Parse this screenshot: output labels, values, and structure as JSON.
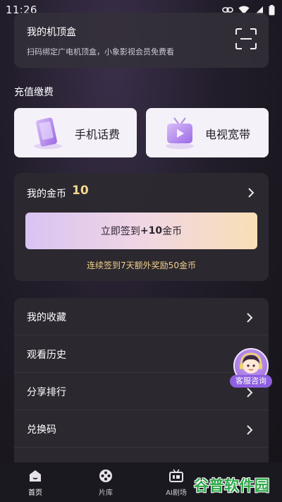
{
  "status_bar": {
    "time": "11:26",
    "icons": [
      "link-icon",
      "wifi-icon",
      "signal-icon",
      "battery-icon"
    ]
  },
  "set_top_box": {
    "title": "我的机顶盒",
    "subtitle": "扫码绑定广电机顶盒，小象影视会员免费看",
    "icon": "scan-icon"
  },
  "recharge": {
    "section_title": "充值缴费",
    "items": [
      {
        "label": "手机话费",
        "icon": "phone-icon"
      },
      {
        "label": "电视宽带",
        "icon": "tv-icon"
      }
    ]
  },
  "coins": {
    "label": "我的金币",
    "count": "10",
    "checkin_prefix": "立即签到",
    "checkin_bonus": "+10",
    "checkin_suffix": "金币",
    "streak_note": "连续签到7天额外奖励50金币"
  },
  "menu": {
    "items": [
      {
        "label": "我的收藏"
      },
      {
        "label": "观看历史"
      },
      {
        "label": "分享排行"
      },
      {
        "label": "兑换码"
      }
    ]
  },
  "customer_service": {
    "label": "客服咨询"
  },
  "tab_bar": {
    "items": [
      {
        "label": "首页",
        "icon": "home-icon"
      },
      {
        "label": "片库",
        "icon": "film-reel-icon"
      },
      {
        "label": "AI剧场",
        "icon": "ai-tv-icon"
      }
    ]
  },
  "watermark": {
    "text": "谷普软件园"
  },
  "colors": {
    "accent_gold": "#f2d98a",
    "checkin_gradient_start": "#d9c3f2",
    "checkin_gradient_end": "#f8dfb6",
    "cs_purple": "#8e5fe0",
    "watermark_green": "#2ea84a"
  }
}
